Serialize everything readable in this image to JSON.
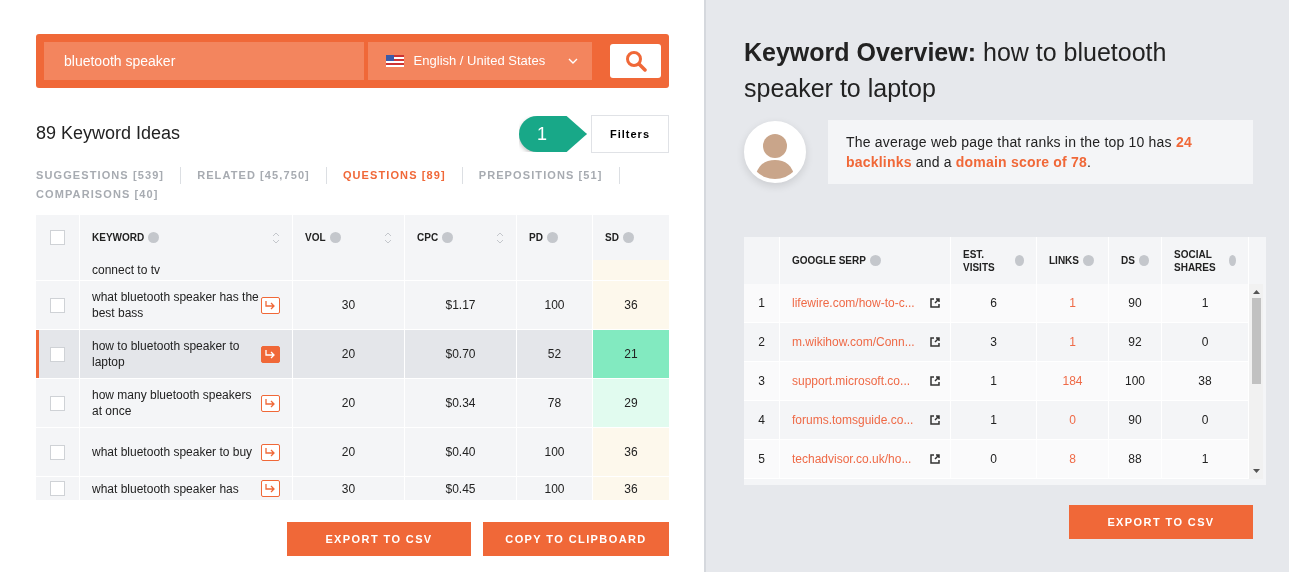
{
  "search": {
    "value": "bluetooth speaker",
    "language": "English / United States"
  },
  "ideas_title": "89 Keyword Ideas",
  "filters": {
    "label": "Filters",
    "callout": "1"
  },
  "tabs": [
    {
      "label": "SUGGESTIONS [539]",
      "selected": false
    },
    {
      "label": "RELATED [45,750]",
      "selected": false
    },
    {
      "label": "QUESTIONS [89]",
      "selected": true
    },
    {
      "label": "PREPOSITIONS [51]",
      "selected": false
    },
    {
      "label": "COMPARISONS [40]",
      "selected": false
    }
  ],
  "keyword_table": {
    "select_all_checked": false,
    "columns": [
      "KEYWORD",
      "VOL",
      "CPC",
      "PD",
      "SD"
    ],
    "rows": [
      {
        "kind": "partial-top",
        "keyword": "connect to tv",
        "selected": false,
        "vol": "",
        "cpc": "",
        "pd": "",
        "sd": "",
        "color": "#fdf8ec"
      },
      {
        "kind": "full",
        "keyword": "what bluetooth speaker has the best bass",
        "checked": false,
        "selected": false,
        "vol": "30",
        "cpc": "$1.17",
        "pd": "100",
        "sd": "36",
        "color": "#fdf8ec"
      },
      {
        "kind": "full",
        "keyword": "how to bluetooth speaker to laptop",
        "checked": false,
        "selected": true,
        "vol": "20",
        "cpc": "$0.70",
        "pd": "52",
        "sd": "21",
        "color": "#82eac0"
      },
      {
        "kind": "full",
        "keyword": "how many bluetooth speakers at once",
        "checked": false,
        "selected": false,
        "vol": "20",
        "cpc": "$0.34",
        "pd": "78",
        "sd": "29",
        "color": "#e1fbef"
      },
      {
        "kind": "full",
        "keyword": "what bluetooth speaker to buy",
        "checked": false,
        "selected": false,
        "vol": "20",
        "cpc": "$0.40",
        "pd": "100",
        "sd": "36",
        "color": "#fdf8ec"
      },
      {
        "kind": "partial-bottom",
        "keyword": "what bluetooth speaker has",
        "checked": false,
        "selected": false,
        "vol": "30",
        "cpc": "$0.45",
        "pd": "100",
        "sd": "36",
        "color": "#fdf8ec"
      }
    ]
  },
  "left_buttons": [
    "EXPORT TO CSV",
    "COPY TO CLIPBOARD"
  ],
  "overview": {
    "title": "**Keyword Overview:** how to bluetooth speaker to laptop",
    "summary": "The average web page that ranks in the top 10 has **24 backlinks** and a **domain score of 78**."
  },
  "serp_table": {
    "columns": [
      "GOOGLE SERP",
      "EST. VISITS",
      "LINKS",
      "DS",
      "SOCIAL SHARES"
    ],
    "rows": [
      {
        "rank": "1",
        "url": "lifewire.com/how-to-c...",
        "visits": "6",
        "links": "1",
        "ds": "90",
        "shares": "1"
      },
      {
        "rank": "2",
        "url": "m.wikihow.com/Conn...",
        "visits": "3",
        "links": "1",
        "ds": "92",
        "shares": "0"
      },
      {
        "rank": "3",
        "url": "support.microsoft.co...",
        "visits": "1",
        "links": "184",
        "ds": "100",
        "shares": "38"
      },
      {
        "rank": "4",
        "url": "forums.tomsguide.co...",
        "visits": "1",
        "links": "0",
        "ds": "90",
        "shares": "0"
      },
      {
        "rank": "5",
        "url": "techadvisor.co.uk/ho...",
        "visits": "0",
        "links": "8",
        "ds": "88",
        "shares": "1"
      }
    ]
  },
  "right_button": "EXPORT TO CSV"
}
